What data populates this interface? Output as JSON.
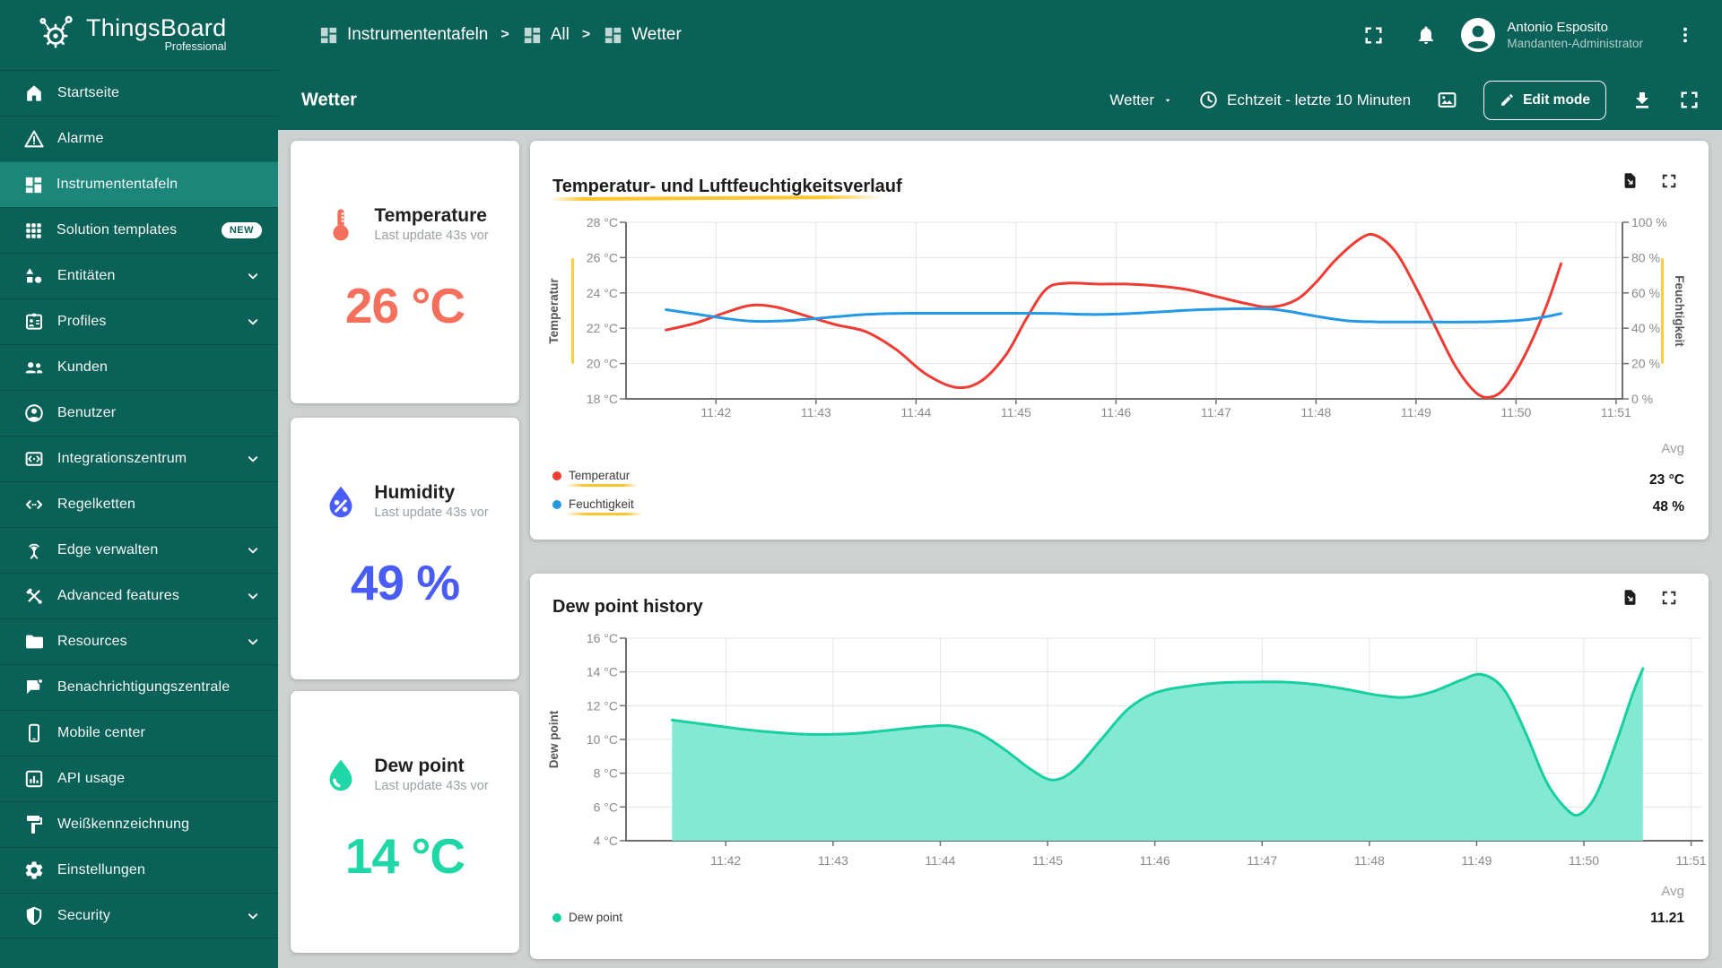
{
  "app": {
    "name": "ThingsBoard",
    "edition": "Professional"
  },
  "breadcrumb": {
    "separator": ">",
    "items": [
      {
        "label": "Instrumententafeln",
        "icon": "dashboards-icon"
      },
      {
        "label": "All",
        "icon": "dashboards-icon"
      },
      {
        "label": "Wetter",
        "icon": "dashboards-icon"
      }
    ]
  },
  "user": {
    "name": "Antonio Esposito",
    "role": "Mandanten-Administrator"
  },
  "toolbar": {
    "page_title": "Wetter",
    "state_select": "Wetter",
    "time_window": "Echtzeit - letzte 10 Minuten",
    "edit_button": "Edit mode"
  },
  "icons": {
    "header": [
      "fullscreen-icon",
      "notifications-bell-icon",
      "avatar-icon",
      "more-vert-icon"
    ],
    "toolbar": [
      "caret-down-icon",
      "clock-icon",
      "dashboard-image-icon",
      "pencil-icon",
      "download-icon",
      "fullscreen-icon"
    ],
    "chart_actions": [
      "export-file-icon",
      "fullscreen-icon"
    ]
  },
  "colors": {
    "primary": "#0A6157",
    "sidebar_selected": "#1C867A",
    "content_bg": "#CDD1CF",
    "temperature": "#F4705C",
    "humidity": "#4A5CF6",
    "dew_point": "#1FD7A6",
    "chart_red": "#EF3B33",
    "chart_blue": "#2498E5",
    "chart_teal": "#17CFA0",
    "chart_teal_fill": "#7CE8D1",
    "accent_yellow": "#FFC52F"
  },
  "sidebar": {
    "items": [
      {
        "label": "Startseite",
        "icon": "home-icon"
      },
      {
        "label": "Alarme",
        "icon": "alert-triangle-icon"
      },
      {
        "label": "Instrumententafeln",
        "icon": "dashboards-icon",
        "selected": true
      },
      {
        "label": "Solution templates",
        "icon": "apps-grid-icon",
        "badge": "NEW"
      },
      {
        "label": "Entitäten",
        "icon": "entities-icon",
        "expandable": true
      },
      {
        "label": "Profiles",
        "icon": "id-badge-icon",
        "expandable": true
      },
      {
        "label": "Kunden",
        "icon": "customers-icon"
      },
      {
        "label": "Benutzer",
        "icon": "user-circle-icon"
      },
      {
        "label": "Integrationszentrum",
        "icon": "integrations-icon",
        "expandable": true
      },
      {
        "label": "Regelketten",
        "icon": "rule-chains-icon"
      },
      {
        "label": "Edge verwalten",
        "icon": "edge-icon",
        "expandable": true
      },
      {
        "label": "Advanced features",
        "icon": "advanced-features-icon",
        "expandable": true
      },
      {
        "label": "Resources",
        "icon": "folder-icon",
        "expandable": true
      },
      {
        "label": "Benachrichtigungszentrale",
        "icon": "notification-center-icon"
      },
      {
        "label": "Mobile center",
        "icon": "mobile-icon"
      },
      {
        "label": "API usage",
        "icon": "api-usage-icon"
      },
      {
        "label": "Weißkennzeichnung",
        "icon": "white-labeling-icon"
      },
      {
        "label": "Einstellungen",
        "icon": "settings-gear-icon"
      },
      {
        "label": "Security",
        "icon": "security-shield-icon",
        "expandable": true
      }
    ]
  },
  "value_cards": [
    {
      "title": "Temperature",
      "subtitle": "Last update 43s vor",
      "value": "26",
      "unit": "°C",
      "icon": "thermometer-icon",
      "color": "#F4705C"
    },
    {
      "title": "Humidity",
      "subtitle": "Last update 43s vor",
      "value": "49",
      "unit": "%",
      "icon": "humidity-droplet-icon",
      "color": "#4A5CF6"
    },
    {
      "title": "Dew point",
      "subtitle": "Last update 43s vor",
      "value": "14",
      "unit": "°C",
      "icon": "dew-droplet-icon",
      "color": "#1FD7A6"
    }
  ],
  "chart_data": [
    {
      "type": "line",
      "title": "Temperatur- und Luftfeuchtigkeitsverlauf",
      "accent_underline": true,
      "x_unit": "minutes after 11:00",
      "x_ticks": [
        "11:42",
        "11:43",
        "11:44",
        "11:45",
        "11:46",
        "11:47",
        "11:48",
        "11:49",
        "11:50",
        "11:51"
      ],
      "y_axis_left": {
        "label": "Temperatur",
        "ticks": [
          "28 °C",
          "26 °C",
          "24 °C",
          "22 °C",
          "20 °C",
          "18 °C"
        ],
        "range": [
          18,
          28
        ]
      },
      "y_axis_right": {
        "label": "Feuchtigkeit",
        "ticks": [
          "100 %",
          "80 %",
          "60 %",
          "40 %",
          "20 %",
          "0 %"
        ],
        "range": [
          0,
          100
        ]
      },
      "series": [
        {
          "name": "Temperatur",
          "color": "#EF3B33",
          "axis": "left",
          "legend_accent": true,
          "points": [
            [
              41.5,
              21.9
            ],
            [
              41.8,
              22.3
            ],
            [
              42.1,
              22.9
            ],
            [
              42.35,
              23.3
            ],
            [
              42.6,
              23.2
            ],
            [
              42.9,
              22.7
            ],
            [
              43.2,
              22.2
            ],
            [
              43.5,
              21.8
            ],
            [
              43.8,
              20.8
            ],
            [
              44.1,
              19.4
            ],
            [
              44.4,
              18.65
            ],
            [
              44.65,
              19.0
            ],
            [
              44.9,
              20.5
            ],
            [
              45.1,
              22.5
            ],
            [
              45.3,
              24.2
            ],
            [
              45.5,
              24.55
            ],
            [
              45.8,
              24.5
            ],
            [
              46.1,
              24.5
            ],
            [
              46.4,
              24.4
            ],
            [
              46.7,
              24.2
            ],
            [
              47.0,
              23.8
            ],
            [
              47.3,
              23.4
            ],
            [
              47.55,
              23.2
            ],
            [
              47.8,
              23.6
            ],
            [
              48.0,
              24.6
            ],
            [
              48.2,
              25.9
            ],
            [
              48.45,
              27.1
            ],
            [
              48.6,
              27.25
            ],
            [
              48.8,
              26.3
            ],
            [
              49.0,
              24.3
            ],
            [
              49.2,
              22.0
            ],
            [
              49.4,
              19.8
            ],
            [
              49.6,
              18.35
            ],
            [
              49.75,
              18.1
            ],
            [
              49.9,
              18.7
            ],
            [
              50.1,
              20.6
            ],
            [
              50.3,
              23.2
            ],
            [
              50.45,
              25.65
            ]
          ]
        },
        {
          "name": "Feuchtigkeit",
          "color": "#2498E5",
          "axis": "right",
          "legend_accent": true,
          "points": [
            [
              41.5,
              50.5
            ],
            [
              41.8,
              48.0
            ],
            [
              42.1,
              45.5
            ],
            [
              42.35,
              44.0
            ],
            [
              42.6,
              44.0
            ],
            [
              42.9,
              45.0
            ],
            [
              43.2,
              46.5
            ],
            [
              43.5,
              47.8
            ],
            [
              43.8,
              48.4
            ],
            [
              44.2,
              48.5
            ],
            [
              44.6,
              48.5
            ],
            [
              45.0,
              48.5
            ],
            [
              45.4,
              48.3
            ],
            [
              45.7,
              47.8
            ],
            [
              46.0,
              48.0
            ],
            [
              46.3,
              48.8
            ],
            [
              46.6,
              49.8
            ],
            [
              46.9,
              50.6
            ],
            [
              47.2,
              51.0
            ],
            [
              47.5,
              51.0
            ],
            [
              47.7,
              49.8
            ],
            [
              48.0,
              46.8
            ],
            [
              48.3,
              44.3
            ],
            [
              48.6,
              43.6
            ],
            [
              48.9,
              43.5
            ],
            [
              49.2,
              43.5
            ],
            [
              49.5,
              43.5
            ],
            [
              49.8,
              43.8
            ],
            [
              50.1,
              44.8
            ],
            [
              50.3,
              46.5
            ],
            [
              50.45,
              48.3
            ]
          ]
        }
      ],
      "summary": {
        "header": "Avg",
        "rows": [
          {
            "name": "Temperatur",
            "value": "23 °C"
          },
          {
            "name": "Feuchtigkeit",
            "value": "48 %"
          }
        ]
      }
    },
    {
      "type": "area",
      "title": "Dew point history",
      "accent_underline": false,
      "x_unit": "minutes after 11:00",
      "x_ticks": [
        "11:42",
        "11:43",
        "11:44",
        "11:45",
        "11:46",
        "11:47",
        "11:48",
        "11:49",
        "11:50",
        "11:51"
      ],
      "y_axis_left": {
        "label": "Dew point",
        "ticks": [
          "16 °C",
          "14 °C",
          "12 °C",
          "10 °C",
          "8 °C",
          "6 °C",
          "4 °C"
        ],
        "range": [
          4,
          16
        ]
      },
      "series": [
        {
          "name": "Dew point",
          "color": "#17CFA0",
          "axis": "left",
          "fill": "#7CE8D1",
          "fill_opacity": 0.95,
          "legend_accent": false,
          "points": [
            [
              41.5,
              11.15
            ],
            [
              41.8,
              10.9
            ],
            [
              42.1,
              10.65
            ],
            [
              42.4,
              10.45
            ],
            [
              42.7,
              10.32
            ],
            [
              43.0,
              10.3
            ],
            [
              43.3,
              10.4
            ],
            [
              43.6,
              10.6
            ],
            [
              43.9,
              10.78
            ],
            [
              44.1,
              10.8
            ],
            [
              44.35,
              10.4
            ],
            [
              44.6,
              9.4
            ],
            [
              44.85,
              8.2
            ],
            [
              45.05,
              7.6
            ],
            [
              45.25,
              8.2
            ],
            [
              45.5,
              10.0
            ],
            [
              45.75,
              11.8
            ],
            [
              46.0,
              12.75
            ],
            [
              46.3,
              13.15
            ],
            [
              46.6,
              13.35
            ],
            [
              46.9,
              13.4
            ],
            [
              47.2,
              13.4
            ],
            [
              47.5,
              13.25
            ],
            [
              47.8,
              12.95
            ],
            [
              48.1,
              12.6
            ],
            [
              48.35,
              12.5
            ],
            [
              48.6,
              12.85
            ],
            [
              48.85,
              13.5
            ],
            [
              49.05,
              13.85
            ],
            [
              49.25,
              13.0
            ],
            [
              49.45,
              10.5
            ],
            [
              49.65,
              7.5
            ],
            [
              49.85,
              5.8
            ],
            [
              49.97,
              5.6
            ],
            [
              50.12,
              6.8
            ],
            [
              50.3,
              9.8
            ],
            [
              50.45,
              12.6
            ],
            [
              50.55,
              14.2
            ]
          ]
        }
      ],
      "summary": {
        "header": "Avg",
        "rows": [
          {
            "name": "Dew point",
            "value": "11.21"
          }
        ]
      }
    }
  ]
}
